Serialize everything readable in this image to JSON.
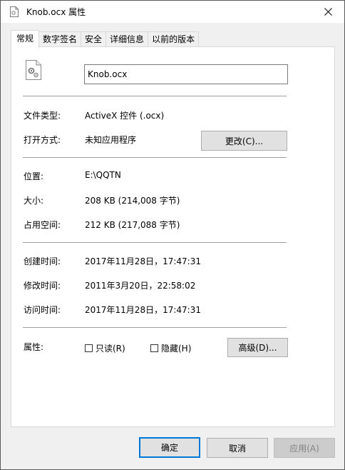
{
  "window": {
    "title": "Knob.ocx 属性"
  },
  "tabs": [
    {
      "label": "常规",
      "active": true
    },
    {
      "label": "数字签名",
      "active": false
    },
    {
      "label": "安全",
      "active": false
    },
    {
      "label": "详细信息",
      "active": false
    },
    {
      "label": "以前的版本",
      "active": false
    }
  ],
  "general": {
    "file_name": "Knob.ocx",
    "file_type_label": "文件类型:",
    "file_type_value": "ActiveX 控件 (.ocx)",
    "opens_with_label": "打开方式:",
    "opens_with_value": "未知应用程序",
    "change_button": "更改(C)...",
    "location_label": "位置:",
    "location_value": "E:\\QQTN",
    "size_label": "大小:",
    "size_value": "208 KB (214,008 字节)",
    "size_on_disk_label": "占用空间:",
    "size_on_disk_value": "212 KB (217,088 字节)",
    "created_label": "创建时间:",
    "created_value": "2017年11月28日，17:47:31",
    "modified_label": "修改时间:",
    "modified_value": "2011年3月20日，22:58:02",
    "accessed_label": "访问时间:",
    "accessed_value": "2017年11月28日，17:47:31",
    "attributes_label": "属性:",
    "readonly_label": "只读(R)",
    "readonly_checked": false,
    "hidden_label": "隐藏(H)",
    "hidden_checked": false,
    "advanced_button": "高级(D)..."
  },
  "footer": {
    "ok_button": "确定",
    "cancel_button": "取消",
    "apply_button": "应用(A)"
  },
  "colors": {
    "accent": "#0078d7",
    "window_bg": "#f0f0f0",
    "panel_bg": "#ffffff"
  }
}
